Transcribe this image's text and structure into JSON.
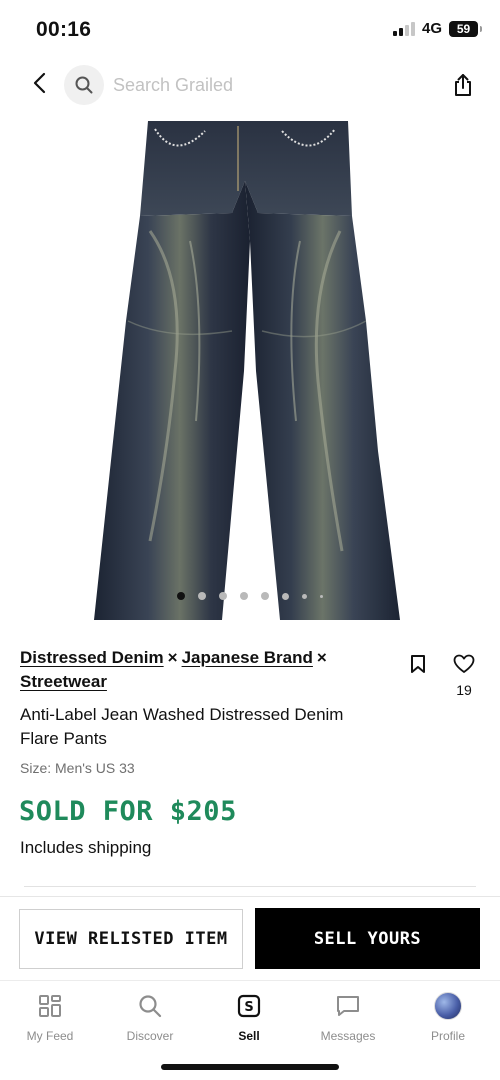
{
  "status_bar": {
    "time": "00:16",
    "network": "4G",
    "battery": "59"
  },
  "header": {
    "back_icon": "chevron-left-icon",
    "search_icon": "search-icon",
    "search_placeholder": "Search Grailed",
    "share_icon": "share-icon"
  },
  "product": {
    "image_description_icon": "product-photo",
    "carousel": {
      "total": 8,
      "active_index": 0
    },
    "brands": [
      "Distressed Denim",
      "Japanese Brand",
      "Streetwear"
    ],
    "brand_separator": "×",
    "title": "Anti-Label Jean Washed Distressed Denim Flare Pants",
    "size": "Size: Men's US 33",
    "sold_text": "SOLD FOR $205",
    "shipping": "Includes shipping",
    "like_count": "19",
    "bookmark_icon": "bookmark-icon",
    "like_icon": "heart-icon"
  },
  "actions": {
    "relisted_label": "VIEW RELISTED ITEM",
    "sell_label": "SELL YOURS"
  },
  "tabs": [
    {
      "label": "My Feed",
      "icon": "feed-grid-icon",
      "active": false
    },
    {
      "label": "Discover",
      "icon": "search-icon",
      "active": false
    },
    {
      "label": "Sell",
      "icon": "sell-s-icon",
      "active": true
    },
    {
      "label": "Messages",
      "icon": "message-icon",
      "active": false
    },
    {
      "label": "Profile",
      "icon": "avatar",
      "active": false
    }
  ],
  "colors": {
    "sold_green": "#1f8a5b",
    "primary_black": "#000000",
    "muted_gray": "#8d8d8d"
  }
}
